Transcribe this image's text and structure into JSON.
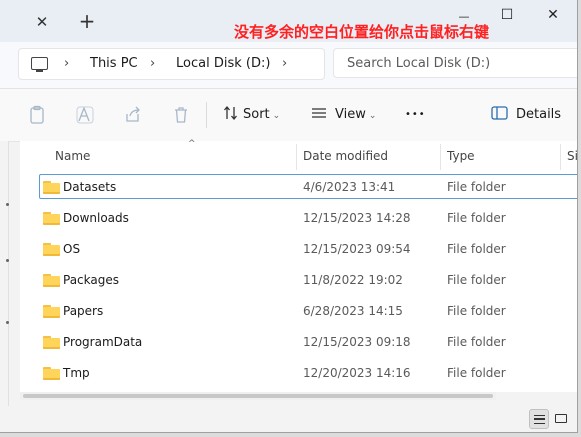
{
  "window": {
    "tab_close_glyph": "✕",
    "new_tab_glyph": "+",
    "minimize_glyph": "—",
    "maximize_glyph": "☐",
    "close_glyph": "✕",
    "annotation_text": "没有多余的空白位置给你点击鼠标右键"
  },
  "breadcrumb": {
    "separator": "›",
    "items": [
      "This PC",
      "Local Disk (D:)"
    ]
  },
  "search": {
    "placeholder": "Search Local Disk (D:)"
  },
  "toolbar": {
    "sort_label": "Sort",
    "view_label": "View",
    "more_label": "•••",
    "details_label": "Details",
    "caret": "⌄"
  },
  "columns": {
    "name": "Name",
    "date_modified": "Date modified",
    "type": "Type",
    "size": "Si",
    "sort_caret": "^"
  },
  "files": [
    {
      "name": "Datasets",
      "date": "4/6/2023 13:41",
      "type": "File folder"
    },
    {
      "name": "Downloads",
      "date": "12/15/2023 14:28",
      "type": "File folder"
    },
    {
      "name": "OS",
      "date": "12/15/2023 09:54",
      "type": "File folder"
    },
    {
      "name": "Packages",
      "date": "11/8/2022 19:02",
      "type": "File folder"
    },
    {
      "name": "Papers",
      "date": "6/28/2023 14:15",
      "type": "File folder"
    },
    {
      "name": "ProgramData",
      "date": "12/15/2023 09:18",
      "type": "File folder"
    },
    {
      "name": "Tmp",
      "date": "12/20/2023 14:16",
      "type": "File folder"
    }
  ],
  "colors": {
    "accent": "#5a9bd6",
    "annotation": "#ff2020",
    "folder": "#ffd45a"
  }
}
